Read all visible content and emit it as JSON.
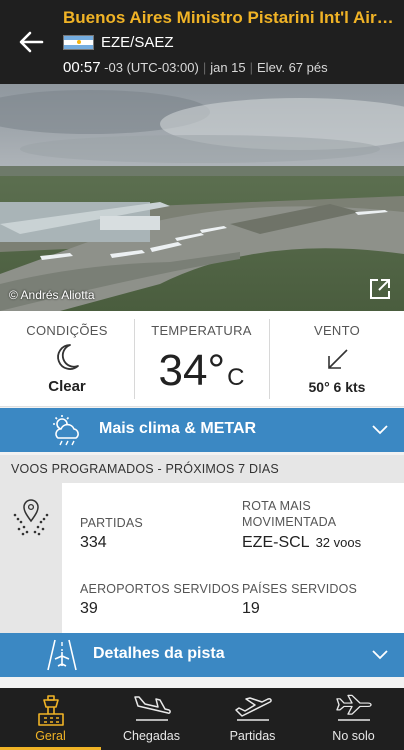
{
  "header": {
    "title": "Buenos Aires Ministro Pistarini Int'l Airport",
    "codes": "EZE/SAEZ",
    "local_time": "00:57",
    "timezone": "-03 (UTC-03:00)",
    "date": "jan 15",
    "elevation": "Elev. 67 pés",
    "back_icon": "arrow-left-icon",
    "flag": "argentina-flag"
  },
  "photo": {
    "credit": "© Andrés Aliotta",
    "external_icon": "open-external-icon"
  },
  "weather": {
    "conditions_label": "CONDIÇÕES",
    "conditions_value": "Clear",
    "conditions_icon": "moon-icon",
    "temperature_label": "TEMPERATURA",
    "temperature_value": "34°",
    "temperature_unit": "C",
    "wind_label": "VENTO",
    "wind_value": "50° 6 kts",
    "wind_icon": "wind-direction-arrow-icon"
  },
  "more_weather": {
    "label": "Mais clima & METAR",
    "icon": "cloud-sun-icon"
  },
  "scheduled": {
    "heading": "VOOS PROGRAMADOS - PRÓXIMOS 7 DIAS",
    "departures_label": "PARTIDAS",
    "departures_value": "334",
    "busiest_route_label_1": "ROTA MAIS",
    "busiest_route_label_2": "MOVIMENTADA",
    "busiest_route_value": "EZE-SCL",
    "busiest_route_flights": "32 voos",
    "airports_label": "AEROPORTOS SERVIDOS",
    "airports_value": "39",
    "countries_label": "PAÍSES SERVIDOS",
    "countries_value": "19"
  },
  "runway": {
    "label": "Detalhes da pista",
    "icon": "runway-icon"
  },
  "nav": {
    "items": [
      {
        "label": "Geral",
        "icon": "airport-tower-icon",
        "active": true
      },
      {
        "label": "Chegadas",
        "icon": "plane-landing-icon",
        "active": false
      },
      {
        "label": "Partidas",
        "icon": "plane-takeoff-icon",
        "active": false
      },
      {
        "label": "No solo",
        "icon": "plane-ground-icon",
        "active": false
      }
    ]
  },
  "colors": {
    "header_bg": "#1f1f1f",
    "accent": "#f0b326",
    "bar_blue": "#3b88c3"
  }
}
